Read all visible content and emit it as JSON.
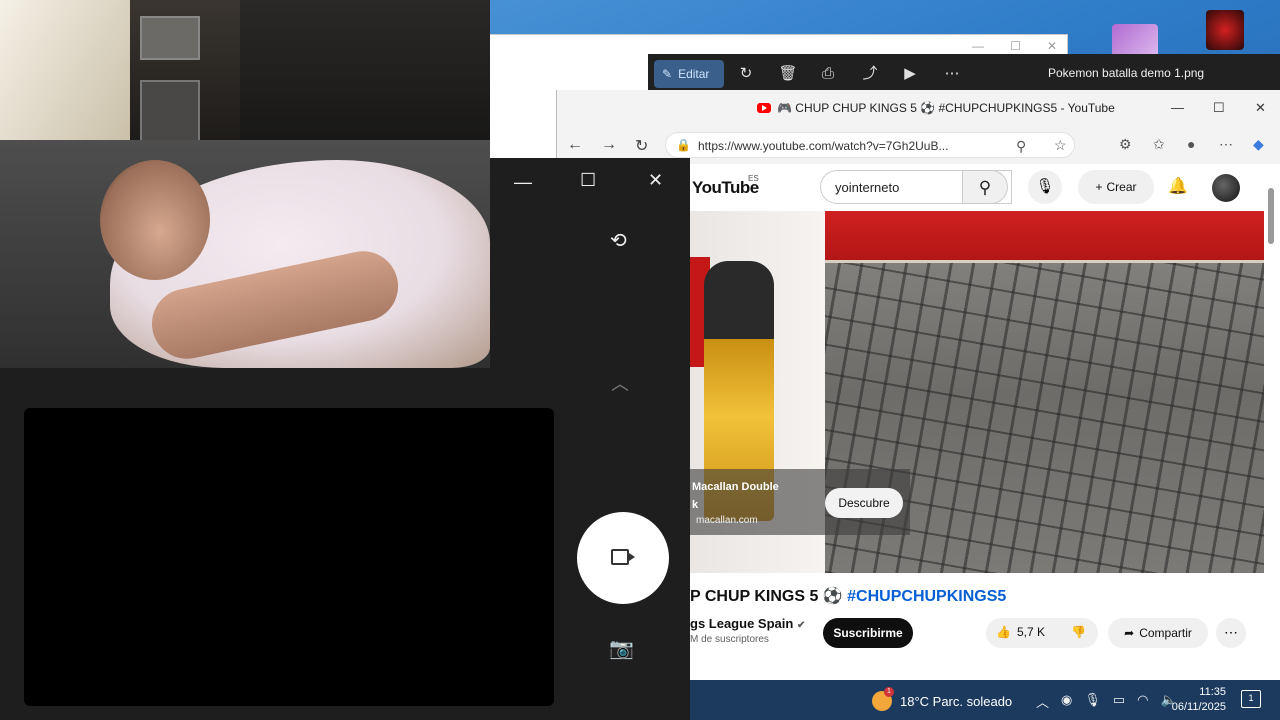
{
  "photo_viewer": {
    "edit_label": "Editar",
    "title": "Pokemon batalla demo 1.png"
  },
  "browser": {
    "tab_title": "🎮 CHUP CHUP KINGS 5 ⚽ #CHUPCHUPKINGS5 - YouTube",
    "url": "https://www.youtube.com/watch?v=7Gh2UuB..."
  },
  "youtube": {
    "logo": "YouTube",
    "region": "ES",
    "search_value": "yointerneto",
    "create_label": "Crear",
    "ad": {
      "name": "Macallan Double",
      "name_line2": "k",
      "url": "macallan.com",
      "cta": "Descubre"
    },
    "video": {
      "title_prefix": "P CHUP KINGS 5 ⚽",
      "title_hashtag": "#CHUPCHUPKINGS5",
      "channel": "gs League Spain",
      "subscribers": "M de suscriptores",
      "subscribe_label": "Suscribirme",
      "likes": "5,7 K",
      "share_label": "Compartir"
    }
  },
  "taskbar": {
    "weather": "18°C  Parc. soleado",
    "time": "11:35",
    "date": "06/11/2025",
    "notifications": "1"
  },
  "colors": {
    "youtube_red": "#ff0000",
    "hashtag_blue": "#065fd4",
    "camera_bg": "#1e1e1e",
    "progress_yellow": "#f5c400"
  }
}
